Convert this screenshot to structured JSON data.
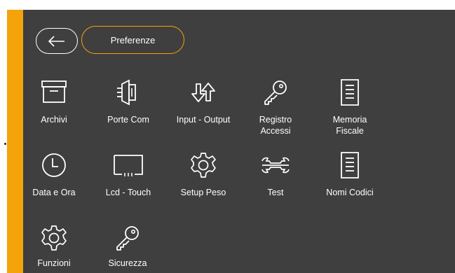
{
  "header": {
    "back_icon": "arrow-left-icon",
    "title": "Preferenze"
  },
  "colors": {
    "accent": "#f4a30a",
    "panel": "#3f3f3f",
    "text": "#ffffff"
  },
  "tiles": [
    {
      "label": "Archivi",
      "icon": "archive-box-icon"
    },
    {
      "label": "Porte Com",
      "icon": "serial-port-icon"
    },
    {
      "label": "Input - Output",
      "icon": "input-output-arrows-icon"
    },
    {
      "label": "Registro\nAccessi",
      "icon": "key-icon"
    },
    {
      "label": "Memoria\nFiscale",
      "icon": "document-icon"
    },
    {
      "label": "Data e Ora",
      "icon": "clock-icon"
    },
    {
      "label": "Lcd - Touch",
      "icon": "lcd-display-icon"
    },
    {
      "label": "Setup Peso",
      "icon": "gear-icon"
    },
    {
      "label": "Test",
      "icon": "wrench-icon"
    },
    {
      "label": "Nomi Codici",
      "icon": "document-icon"
    },
    {
      "label": "Funzioni",
      "icon": "gear-icon"
    },
    {
      "label": "Sicurezza",
      "icon": "key-icon"
    }
  ]
}
